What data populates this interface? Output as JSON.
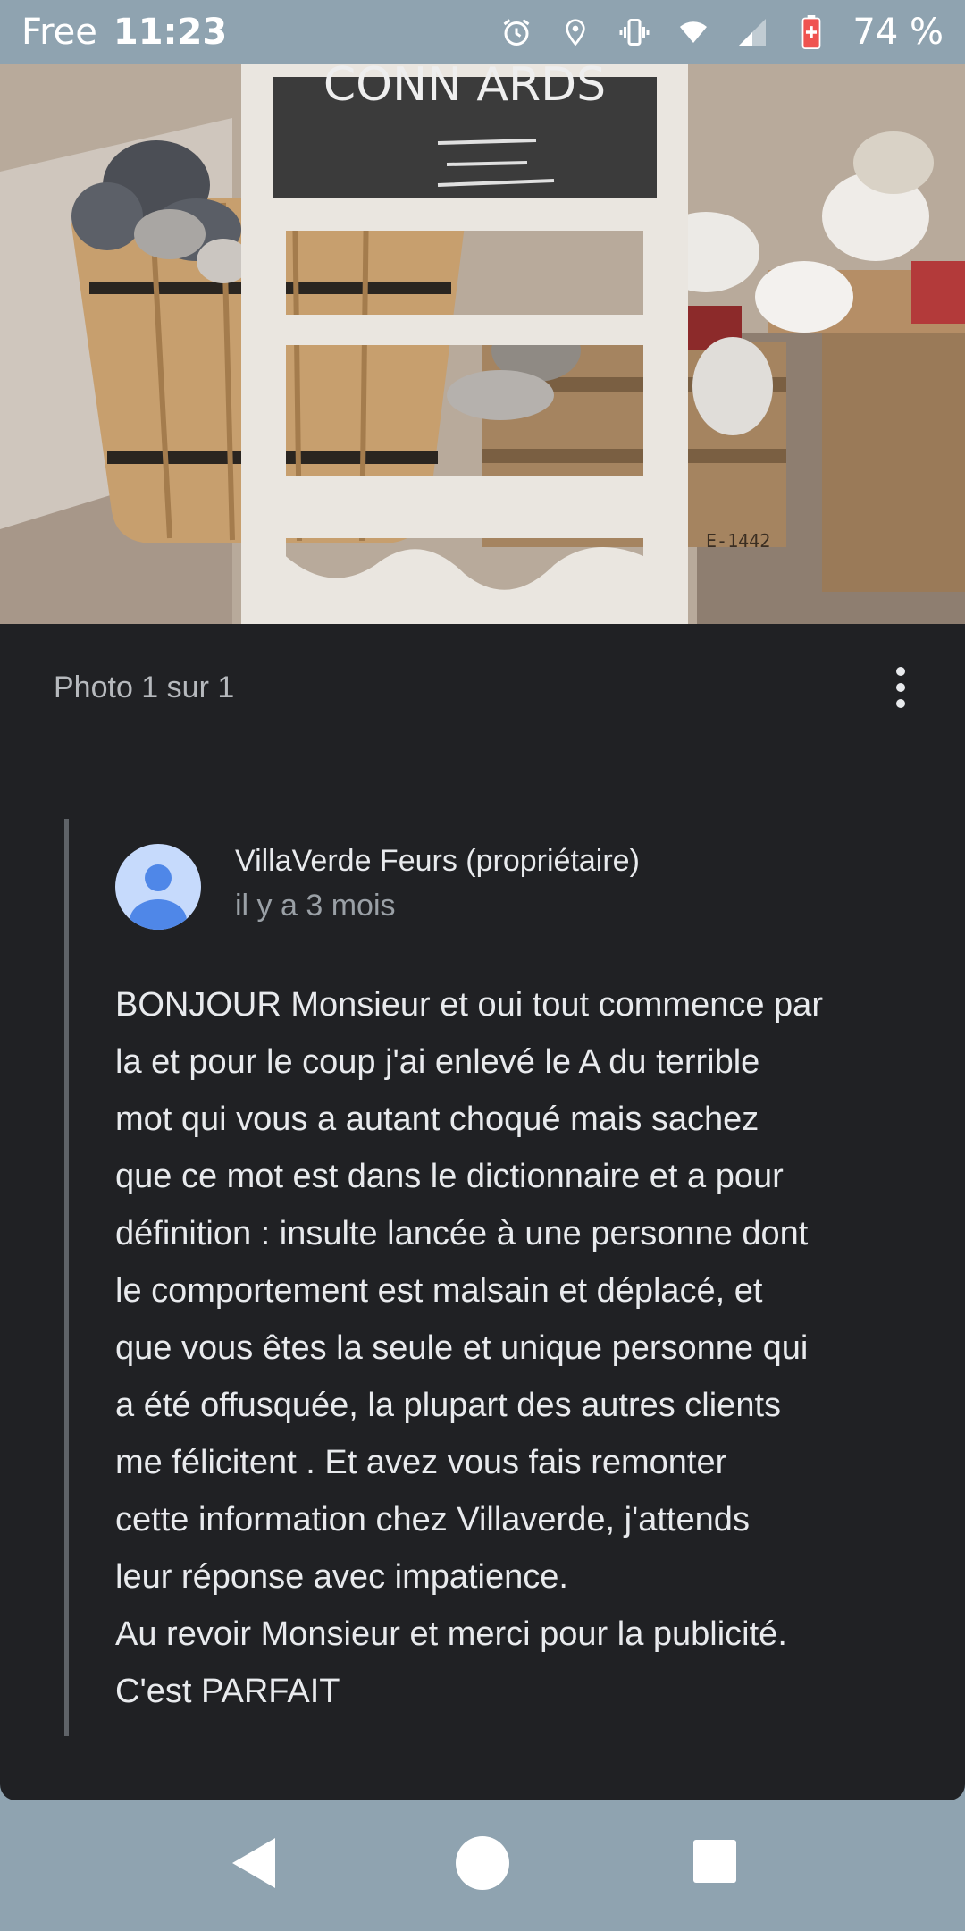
{
  "status_bar": {
    "carrier": "Free",
    "time": "11:23",
    "battery_percent": "74 %",
    "icons": [
      "alarm-icon",
      "location-icon",
      "vibrate-icon",
      "wifi-icon",
      "signal-icon",
      "battery-icon"
    ]
  },
  "photo": {
    "sign_text": "CONN ARDS",
    "crate_label": "E-1442"
  },
  "viewer": {
    "counter": "Photo 1 sur 1",
    "more_icon": "more-vert-icon"
  },
  "reply": {
    "author": "VillaVerde Feurs (propriétaire)",
    "time_ago": "il y a 3 mois",
    "lines": [
      "BONJOUR Monsieur et oui tout commence par",
      "la et pour le coup j'ai enlevé le A du terrible",
      "mot qui vous a autant choqué mais sachez",
      "que ce mot est dans le dictionnaire et a pour",
      "définition : insulte lancée à une personne dont",
      "le comportement est malsain et déplacé, et",
      "que vous êtes la seule et unique personne qui",
      "a été offusquée, la plupart des autres clients",
      "me félicitent . Et avez vous fais remonter",
      "cette information chez Villaverde, j'attends",
      "leur réponse avec impatience.",
      "Au revoir Monsieur et merci pour la publicité.",
      "C'est PARFAIT"
    ]
  },
  "nav_bar": {
    "icons": [
      "back-icon",
      "home-icon",
      "recents-icon"
    ]
  },
  "colors": {
    "panel_bg": "#202124",
    "system_bar": "#8fa3b0",
    "avatar_bg": "#c6dafc",
    "avatar_fg": "#4f87e8"
  }
}
